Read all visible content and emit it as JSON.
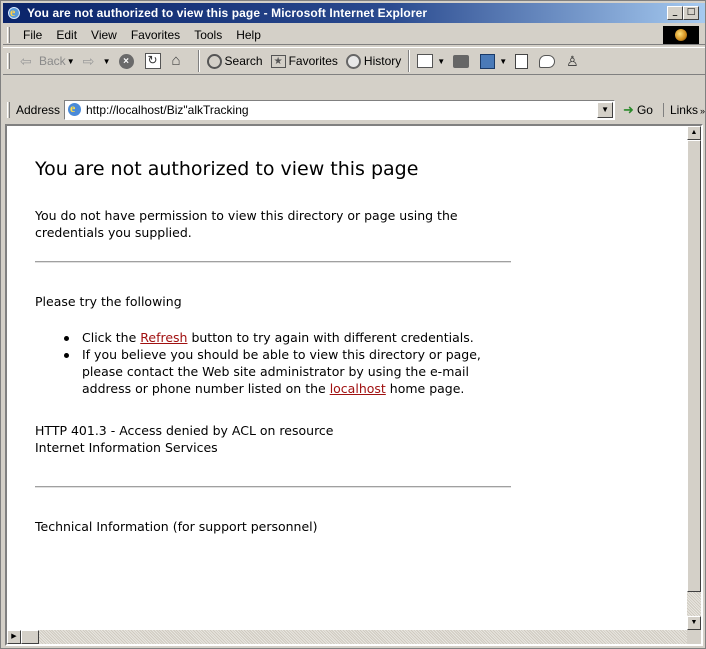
{
  "window": {
    "title": "You are not authorized to view this page - Microsoft Internet Explorer",
    "min_symbol": "_",
    "max_symbol": "□"
  },
  "menubar": {
    "items": [
      "File",
      "Edit",
      "View",
      "Favorites",
      "Tools",
      "Help"
    ]
  },
  "toolbar": {
    "back_label": "Back",
    "search_label": "Search",
    "favorites_label": "Favorites",
    "history_label": "History"
  },
  "address": {
    "label": "Address",
    "url": "http://localhost/Biz\"alkTracking",
    "go_label": "Go",
    "links_label": "Links"
  },
  "page": {
    "heading": "You are not authorized to view this page",
    "permission_text": "You do not have permission to view this directory or page using the credentials you supplied.",
    "try_heading": "Please try the following",
    "bullet1_before": "Click the ",
    "bullet1_link": "Refresh",
    "bullet1_after": " button to try again with different credentials.",
    "bullet2_before": "If you believe you should be able to view this directory or page, please contact the Web site administrator by using the e-mail address or phone number listed on the ",
    "bullet2_link": "localhost",
    "bullet2_after": " home page.",
    "http_error": "HTTP 401.3 - Access denied by ACL on resource",
    "iis_label": "Internet Information Services",
    "tech_info": "Technical Information (for support personnel)"
  },
  "colors": {
    "title_gradient_start": "#0a246a",
    "title_gradient_end": "#a6caf0",
    "link": "#a01010",
    "chrome": "#d4d0c8"
  }
}
